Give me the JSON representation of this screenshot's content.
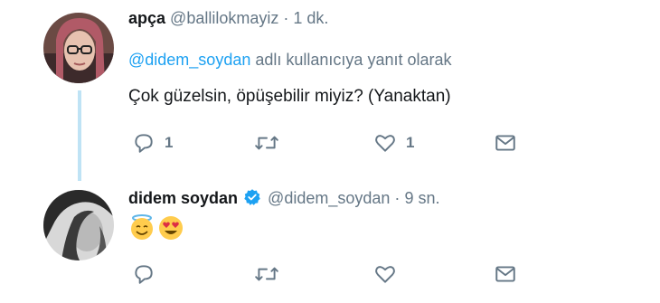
{
  "tweets": [
    {
      "name": "apça",
      "handle": "@ballilokmayiz",
      "dot": "·",
      "time": "1 dk.",
      "reply_prefix_mention": "@didem_soydan",
      "reply_suffix": "adlı kullanıcıya yanıt olarak",
      "text": "Çok güzelsin, öpüşebilir miyiz? (Yanaktan)",
      "actions": {
        "reply_count": "1",
        "retweet_count": "",
        "like_count": "1"
      }
    },
    {
      "name": "didem soydan",
      "verified": true,
      "handle": "@didem_soydan",
      "dot": "·",
      "time": "9 sn.",
      "emojis": [
        "smiling-face-with-halo-icon",
        "heart-eyes-icon"
      ],
      "actions": {
        "reply_count": "",
        "retweet_count": "",
        "like_count": ""
      }
    }
  ],
  "colors": {
    "link": "#1da1f2",
    "secondary": "#657786",
    "thread_line": "#bfe3f5"
  }
}
